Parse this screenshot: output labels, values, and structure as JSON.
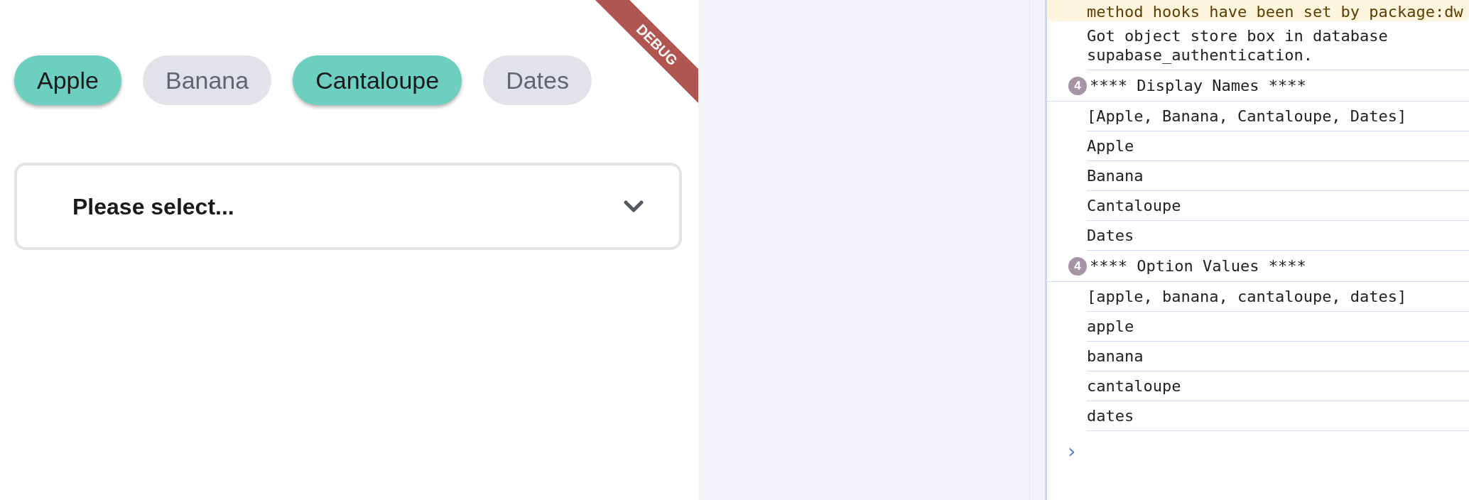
{
  "app": {
    "debug_banner": "DEBUG",
    "chips": [
      {
        "label": "Apple",
        "selected": true
      },
      {
        "label": "Banana",
        "selected": false
      },
      {
        "label": "Cantaloupe",
        "selected": true
      },
      {
        "label": "Dates",
        "selected": false
      }
    ],
    "dropdown": {
      "placeholder": "Please select..."
    }
  },
  "console": {
    "messages": [
      {
        "kind": "warning",
        "text": "method hooks have been set by package:dw"
      },
      {
        "kind": "log",
        "text": "Got object store box in database\nsupabase_authentication."
      },
      {
        "kind": "group",
        "count": "4",
        "text": "**** Display Names ****"
      },
      {
        "kind": "log",
        "text": "[Apple, Banana, Cantaloupe, Dates]"
      },
      {
        "kind": "log",
        "text": "Apple"
      },
      {
        "kind": "log",
        "text": "Banana"
      },
      {
        "kind": "log",
        "text": "Cantaloupe"
      },
      {
        "kind": "log",
        "text": "Dates"
      },
      {
        "kind": "group",
        "count": "4",
        "text": "**** Option Values ****"
      },
      {
        "kind": "log",
        "text": "[apple, banana, cantaloupe, dates]"
      },
      {
        "kind": "log",
        "text": "apple"
      },
      {
        "kind": "log",
        "text": "banana"
      },
      {
        "kind": "log",
        "text": "cantaloupe"
      },
      {
        "kind": "log",
        "text": "dates"
      }
    ],
    "prompt": "›"
  }
}
